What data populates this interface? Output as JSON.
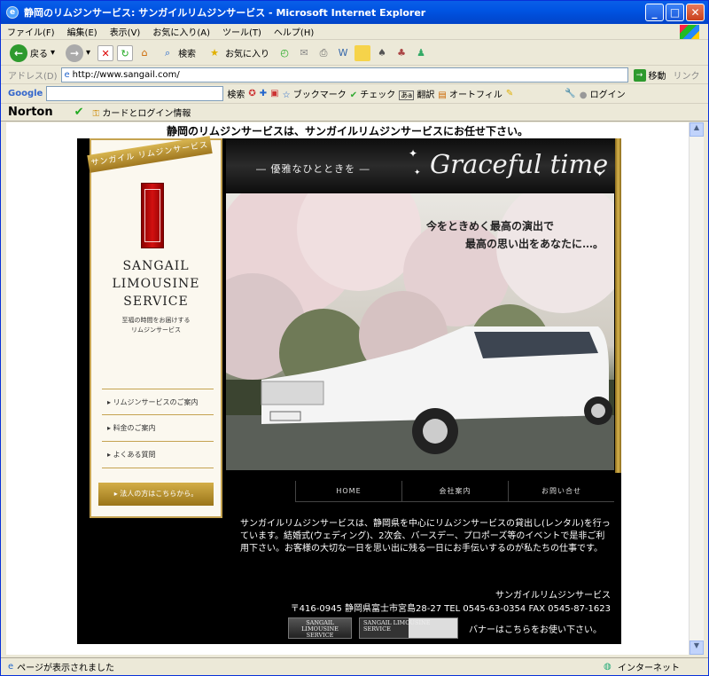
{
  "window": {
    "title": "静岡のリムジンサービス: サンガイルリムジンサービス - Microsoft Internet Explorer",
    "min": "_",
    "max": "□",
    "close": "✕"
  },
  "menu": [
    "ファイル(F)",
    "編集(E)",
    "表示(V)",
    "お気に入り(A)",
    "ツール(T)",
    "ヘルプ(H)"
  ],
  "toolbar": {
    "back": "戻る",
    "search": "検索",
    "favorites": "お気に入り"
  },
  "address": {
    "label": "アドレス(D)",
    "url": "http://www.sangail.com/",
    "go": "移動",
    "links": "リンク"
  },
  "google": {
    "brand": "Google",
    "search": "検索",
    "bookmarks": "ブックマーク",
    "check": "チェック",
    "translate": "翻訳",
    "autofill": "オートフィル",
    "login": "ログイン"
  },
  "norton": {
    "brand": "Norton",
    "cards": "カードとログイン情報"
  },
  "page": {
    "heading": "静岡のリムジンサービスは、サンガイルリムジンサービスにお任せ下さい。",
    "ribbon": "サンガイル リムジンサービス",
    "brand_lines": [
      "SANGAIL",
      "LIMOUSINE",
      "SERVICE"
    ],
    "sub_lines": [
      "至福の時間をお届けする",
      "リムジンサービス"
    ],
    "tagline": "― 優雅なひとときを ―",
    "graceful": "Graceful time",
    "catch1": "今をときめく最高の演出で",
    "catch2": "最高の思い出をあなたに…。",
    "nav": [
      "リムジンサービスのご案内",
      "料金のご案内",
      "よくある質問"
    ],
    "corporate": "法人の方はこちらから。",
    "topnav": [
      "HOME",
      "会社案内",
      "お問い合せ"
    ],
    "description": "サンガイルリムジンサービスは、静岡県を中心にリムジンサービスの貸出し(レンタル)を行っています。結婚式(ウェディング)、2次会、バースデー、プロポーズ等のイベントで是非ご利用下さい。お客様の大切な一日を思い出に残る一日にお手伝いするのが私たちの仕事です。",
    "company_name": "サンガイルリムジンサービス",
    "company_address": "〒416-0945 静岡県富士市宮島28-27 TEL 0545-63-0354 FAX 0545-87-1623",
    "banner_label": "SANGAIL LIMOUSINE SERVICE",
    "banner_text": "バナーはこちらをお使い下さい。"
  },
  "status": {
    "text": "ページが表示されました",
    "zone": "インターネット"
  }
}
